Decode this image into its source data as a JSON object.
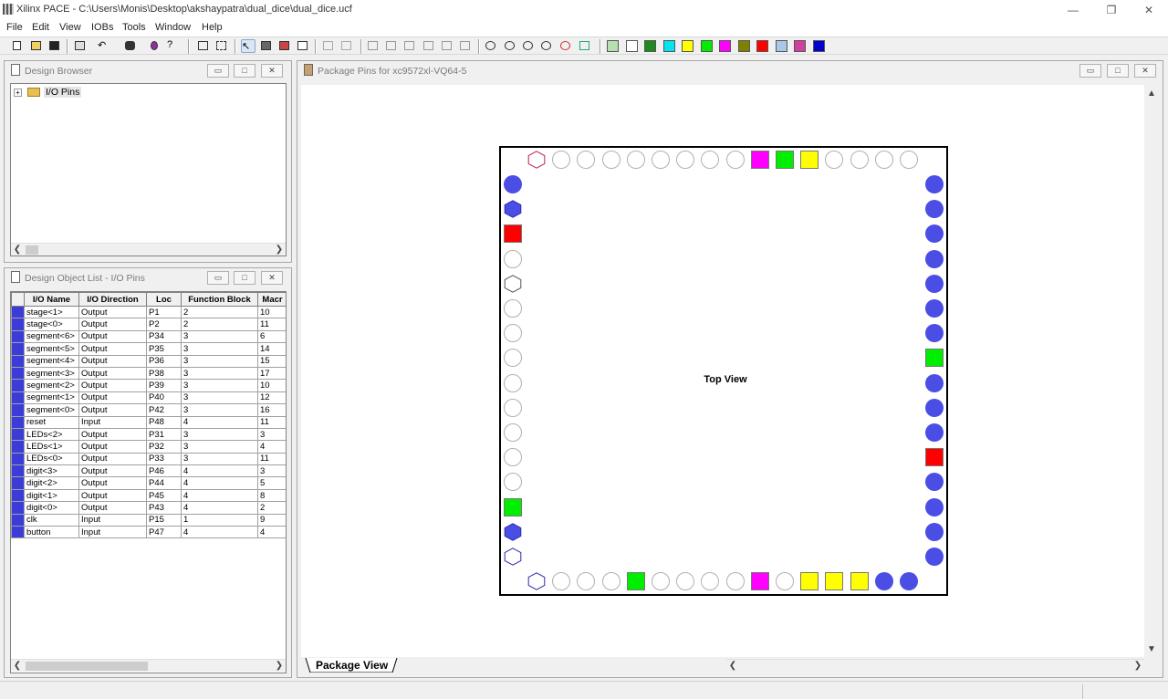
{
  "window": {
    "title": "Xilinx PACE - C:\\Users\\Monis\\Desktop\\akshaypatra\\dual_dice\\dual_dice.ucf"
  },
  "menu": [
    "File",
    "Edit",
    "View",
    "IOBs",
    "Tools",
    "Window",
    "Help"
  ],
  "palette": [
    "#b7dfb0",
    "#ffffff",
    "#1f8a1f",
    "#00e5ee",
    "#ffff00",
    "#00ee00",
    "#ff00ff",
    "#808000",
    "#ff0000",
    "#a8c8e8",
    "#d040a0",
    "#0000cc"
  ],
  "design_browser": {
    "title": "Design Browser",
    "root_label": "I/O Pins"
  },
  "object_list": {
    "title": "Design Object List - I/O Pins",
    "columns": [
      "I/O Name",
      "I/O Direction",
      "Loc",
      "Function Block",
      "Macr"
    ],
    "rows": [
      [
        "stage<1>",
        "Output",
        "P1",
        "2",
        "10"
      ],
      [
        "stage<0>",
        "Output",
        "P2",
        "2",
        "11"
      ],
      [
        "segment<6>",
        "Output",
        "P34",
        "3",
        "6"
      ],
      [
        "segment<5>",
        "Output",
        "P35",
        "3",
        "14"
      ],
      [
        "segment<4>",
        "Output",
        "P36",
        "3",
        "15"
      ],
      [
        "segment<3>",
        "Output",
        "P38",
        "3",
        "17"
      ],
      [
        "segment<2>",
        "Output",
        "P39",
        "3",
        "10"
      ],
      [
        "segment<1>",
        "Output",
        "P40",
        "3",
        "12"
      ],
      [
        "segment<0>",
        "Output",
        "P42",
        "3",
        "16"
      ],
      [
        "reset",
        "Input",
        "P48",
        "4",
        "11"
      ],
      [
        "LEDs<2>",
        "Output",
        "P31",
        "3",
        "3"
      ],
      [
        "LEDs<1>",
        "Output",
        "P32",
        "3",
        "4"
      ],
      [
        "LEDs<0>",
        "Output",
        "P33",
        "3",
        "11"
      ],
      [
        "digit<3>",
        "Output",
        "P46",
        "4",
        "3"
      ],
      [
        "digit<2>",
        "Output",
        "P44",
        "4",
        "5"
      ],
      [
        "digit<1>",
        "Output",
        "P45",
        "4",
        "8"
      ],
      [
        "digit<0>",
        "Output",
        "P43",
        "4",
        "2"
      ],
      [
        "clk",
        "Input",
        "P15",
        "1",
        "9"
      ],
      [
        "button",
        "Input",
        "P47",
        "4",
        "4"
      ]
    ]
  },
  "package_view": {
    "title": "Package Pins for xc9572xl-VQ64-5",
    "center_label": "Top View",
    "tab_label": "Package View",
    "pin_types": {
      "top": [
        "hex-red",
        "c",
        "c",
        "c",
        "c",
        "c",
        "c",
        "c",
        "c",
        "sq-magenta",
        "sq-green",
        "sq-yellow",
        "c",
        "c",
        "c",
        "c"
      ],
      "left": [
        "cb",
        "hex-blue",
        "sq-red",
        "c",
        "hex",
        "c",
        "c",
        "c",
        "c",
        "c",
        "c",
        "c",
        "c",
        "sq-green",
        "hex-blue",
        "hex-outline-blue"
      ],
      "right": [
        "cb",
        "cb",
        "cb",
        "cb",
        "cb",
        "cb",
        "cb",
        "sq-green",
        "cb",
        "cb",
        "cb",
        "sq-red",
        "cb",
        "cb",
        "cb",
        "cb"
      ],
      "bottom": [
        "hex-outline-blue",
        "c",
        "c",
        "c",
        "sq-green",
        "c",
        "c",
        "c",
        "c",
        "sq-magenta",
        "c",
        "sq-yellow",
        "sq-yellow",
        "sq-yellow",
        "cb",
        "cb"
      ]
    }
  }
}
